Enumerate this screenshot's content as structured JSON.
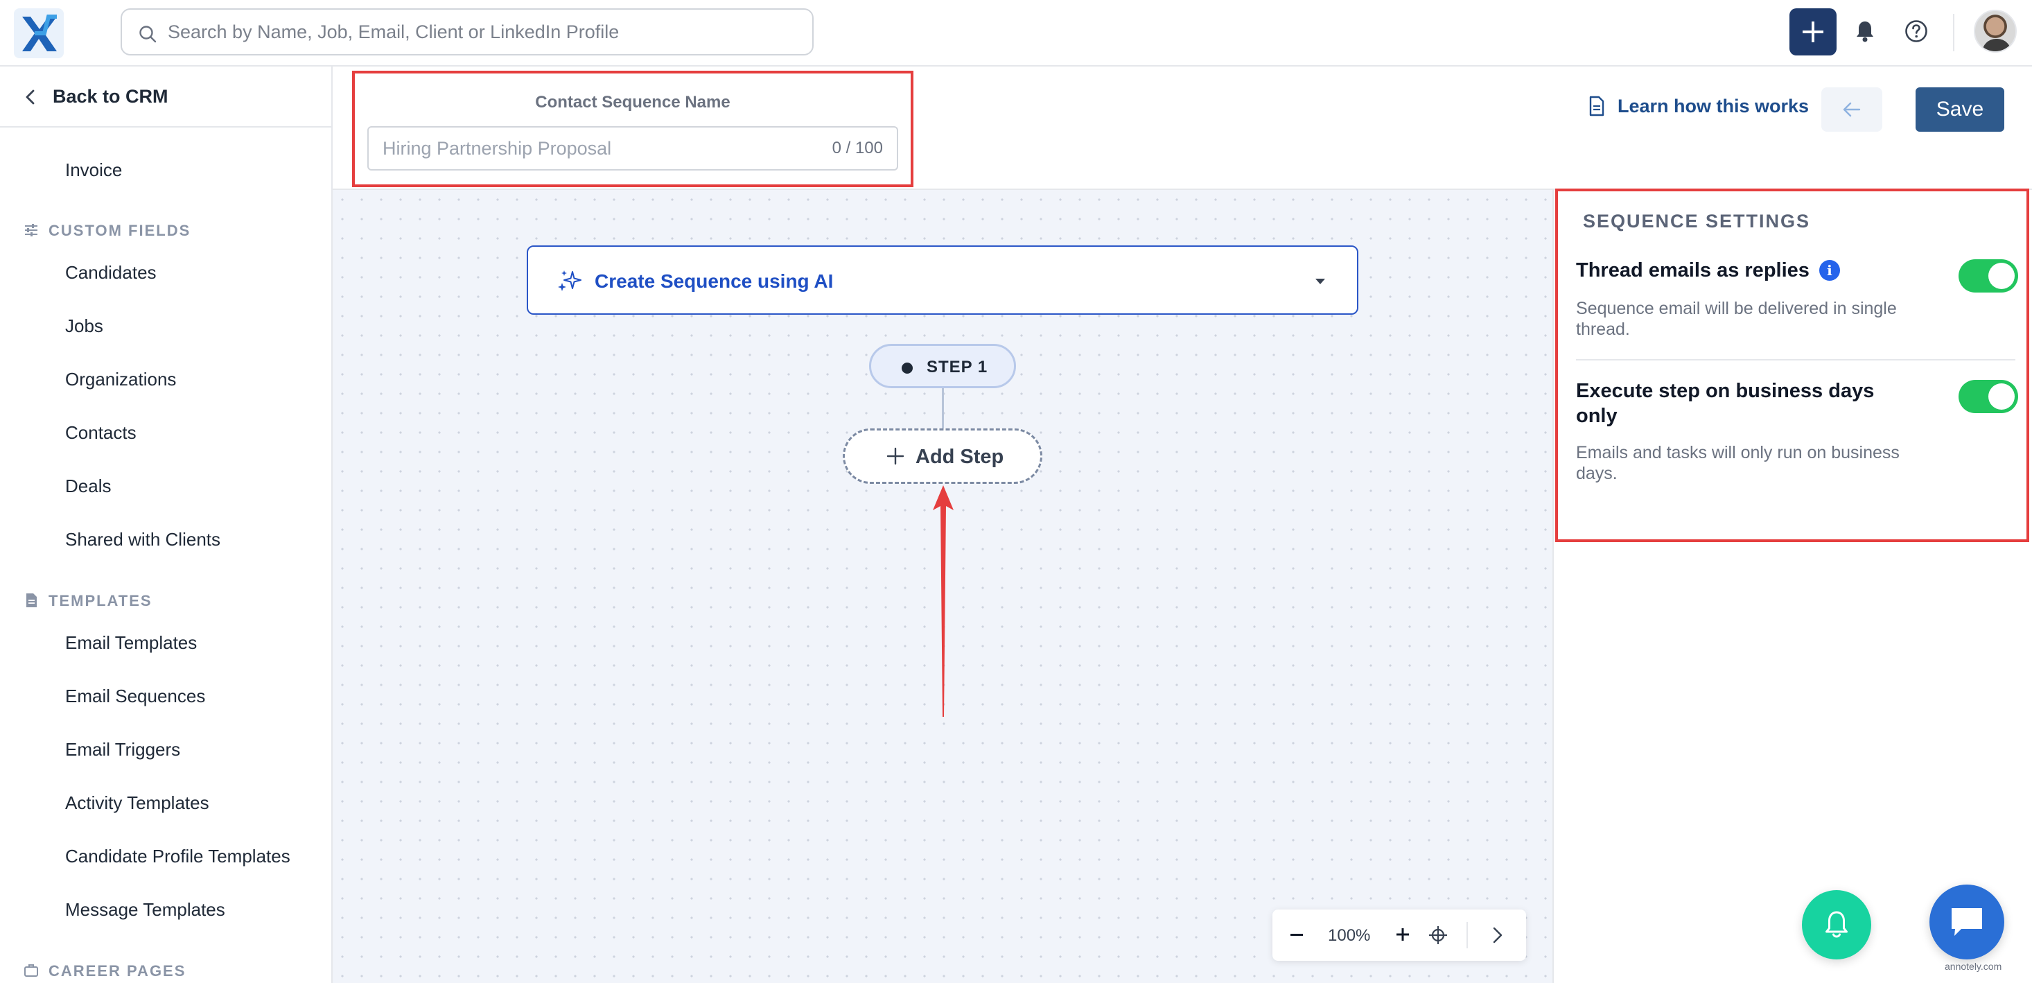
{
  "topbar": {
    "search_placeholder": "Search by Name, Job, Email, Client or LinkedIn Profile"
  },
  "sidebar": {
    "back_label": "Back to CRM",
    "invoice": "Invoice",
    "custom_fields_heading": "CUSTOM FIELDS",
    "custom_fields": [
      "Candidates",
      "Jobs",
      "Organizations",
      "Contacts",
      "Deals",
      "Shared with Clients"
    ],
    "templates_heading": "TEMPLATES",
    "templates": [
      "Email Templates",
      "Email Sequences",
      "Email Triggers",
      "Activity Templates",
      "Candidate Profile Templates",
      "Message Templates"
    ],
    "career_pages_heading": "CAREER PAGES"
  },
  "header": {
    "name_label": "Contact Sequence Name",
    "name_placeholder": "Hiring Partnership Proposal",
    "char_count": "0 / 100",
    "learn_label": "Learn how this works",
    "save_label": "Save"
  },
  "canvas": {
    "ai_label": "Create Sequence using AI",
    "step_label": "STEP 1",
    "add_step_label": "Add Step",
    "zoom": "100%"
  },
  "settings": {
    "title": "SEQUENCE SETTINGS",
    "rows": [
      {
        "title": "Thread emails as replies",
        "desc": "Sequence email will be delivered in single thread.",
        "enabled": true
      },
      {
        "title": "Execute step on business days only",
        "desc": "Emails and tasks will only run on business days.",
        "enabled": true
      }
    ]
  },
  "colors": {
    "accent": "#1f3a6b",
    "highlight": "#e53e3e",
    "toggle_on": "#22c55e",
    "ai_blue": "#1f4fc4"
  },
  "watermark": "annotely.com"
}
